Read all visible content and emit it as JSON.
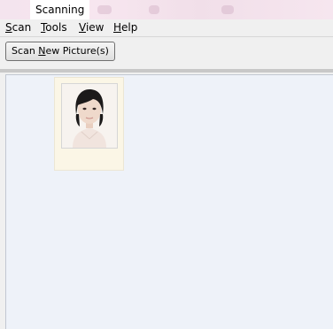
{
  "window": {
    "title": "Scanning"
  },
  "menu": {
    "items": [
      {
        "label": "Scan",
        "mnemonic": "S"
      },
      {
        "label": "Tools",
        "mnemonic": "T"
      },
      {
        "label": "View",
        "mnemonic": "V"
      },
      {
        "label": "Help",
        "mnemonic": "H"
      }
    ]
  },
  "toolbar": {
    "scan_button": {
      "prefix": "Scan ",
      "mnemonic": "N",
      "suffix": "ew Picture(s)"
    }
  },
  "scanned_items": [
    {
      "kind": "photo",
      "subject": "portrait"
    }
  ]
}
